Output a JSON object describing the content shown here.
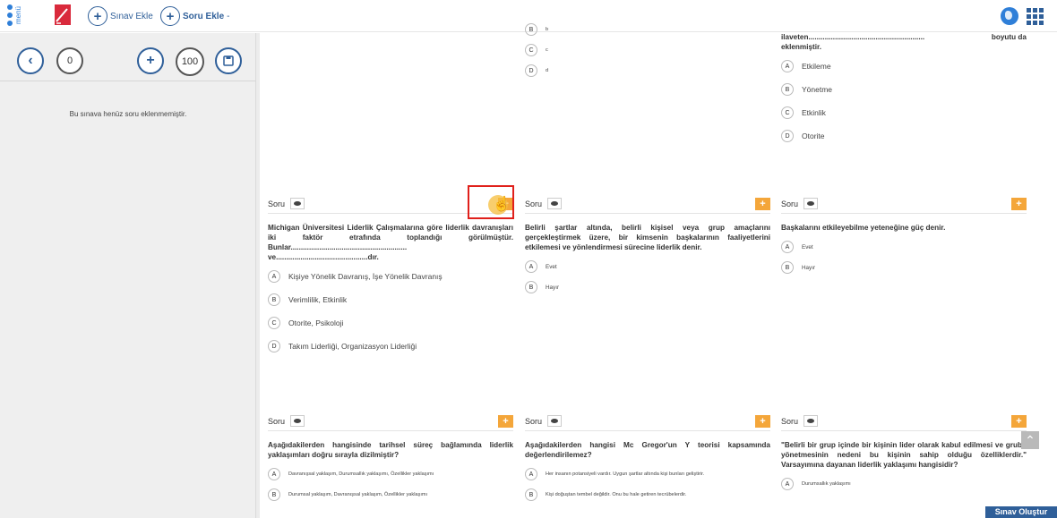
{
  "topbar": {
    "menu_label": "menü",
    "add_exam_label": "Sınav Ekle",
    "add_question_label": "Soru Ekle",
    "add_question_suffix": "-"
  },
  "sidebar": {
    "count_value": "0",
    "total_value": "100",
    "empty_message": "Bu sınava henüz soru eklenmemiştir."
  },
  "cards_top": [
    {
      "options": [
        {
          "letter": "B",
          "text": "b"
        },
        {
          "letter": "C",
          "text": "c"
        },
        {
          "letter": "D",
          "text": "d"
        }
      ]
    },
    {
      "question_tail_1": "ilaveten.........................................................",
      "question_tail_1_right": "boyutu da",
      "question_tail_2": "eklenmiştir.",
      "options": [
        {
          "letter": "A",
          "text": "Etkileme"
        },
        {
          "letter": "B",
          "text": "Yönetme"
        },
        {
          "letter": "C",
          "text": "Etkinlik"
        },
        {
          "letter": "D",
          "text": "Otorite"
        }
      ]
    }
  ],
  "cards_mid": [
    {
      "soru_label": "Soru",
      "add_label": "+",
      "question": "Michigan Üniversitesi Liderlik Çalışmalarına göre liderlik davranışları iki faktör etrafında toplandığı görülmüştür. Bunlar......................................................... ve.............................................dır.",
      "options": [
        {
          "letter": "A",
          "text": "Kişiye Yönelik Davranış, İşe Yönelik Davranış"
        },
        {
          "letter": "B",
          "text": "Verimlilik, Etkinlik"
        },
        {
          "letter": "C",
          "text": "Otorite, Psikoloji"
        },
        {
          "letter": "D",
          "text": "Takım Liderliği, Organizasyon Liderliği"
        }
      ]
    },
    {
      "soru_label": "Soru",
      "add_label": "+",
      "question": "Belirli şartlar altında, belirli kişisel veya grup amaçlarını gerçekleştirmek üzere, bir kimsenin başkalarının faaliyetlerini etkilemesi ve yönlendirmesi sürecine liderlik denir.",
      "options": [
        {
          "letter": "A",
          "text": "Evet"
        },
        {
          "letter": "B",
          "text": "Hayır"
        }
      ]
    },
    {
      "soru_label": "Soru",
      "add_label": "+",
      "question": "Başkalarını etkileyebilme yeteneğine güç denir.",
      "options": [
        {
          "letter": "A",
          "text": "Evet"
        },
        {
          "letter": "B",
          "text": "Hayır"
        }
      ]
    }
  ],
  "cards_bottom": [
    {
      "soru_label": "Soru",
      "add_label": "+",
      "question": "Aşağıdakilerden hangisinde tarihsel süreç bağlamında liderlik yaklaşımları doğru sırayla dizilmiştir?",
      "options": [
        {
          "letter": "A",
          "text": "Davranışsal yaklaşım, Durumsallık yaklaşımı, Özellikler yaklaşımı"
        },
        {
          "letter": "B",
          "text": "Durumsal yaklaşım, Davranışsal yaklaşım, Özellikler yaklaşımı"
        }
      ]
    },
    {
      "soru_label": "Soru",
      "add_label": "+",
      "question": "Aşağıdakilerden hangisi Mc Gregor'un Y teorisi kapsamında değerlendirilemez?",
      "options": [
        {
          "letter": "A",
          "text": "Her insanın potansiyeli vardır. Uygun şartlar altında kişi bunları geliştirir."
        },
        {
          "letter": "B",
          "text": "Kişi doğuştan tembel değildir. Onu bu hale getiren tecrübelerdir."
        }
      ]
    },
    {
      "soru_label": "Soru",
      "add_label": "+",
      "question": "\"Belirli bir grup içinde bir kişinin lider olarak kabul edilmesi ve grubu yönetmesinin nedeni bu kişinin sahip olduğu özelliklerdir.\" Varsayımına dayanan liderlik yaklaşımı hangisidir?",
      "options": [
        {
          "letter": "A",
          "text": "Durumsallık yaklaşımı"
        }
      ]
    }
  ],
  "footer": {
    "create_exam_label": "Sınav Oluştur"
  },
  "colors": {
    "primary": "#2f5f99",
    "accent": "#f4a63a",
    "highlight": "#e0201b"
  }
}
